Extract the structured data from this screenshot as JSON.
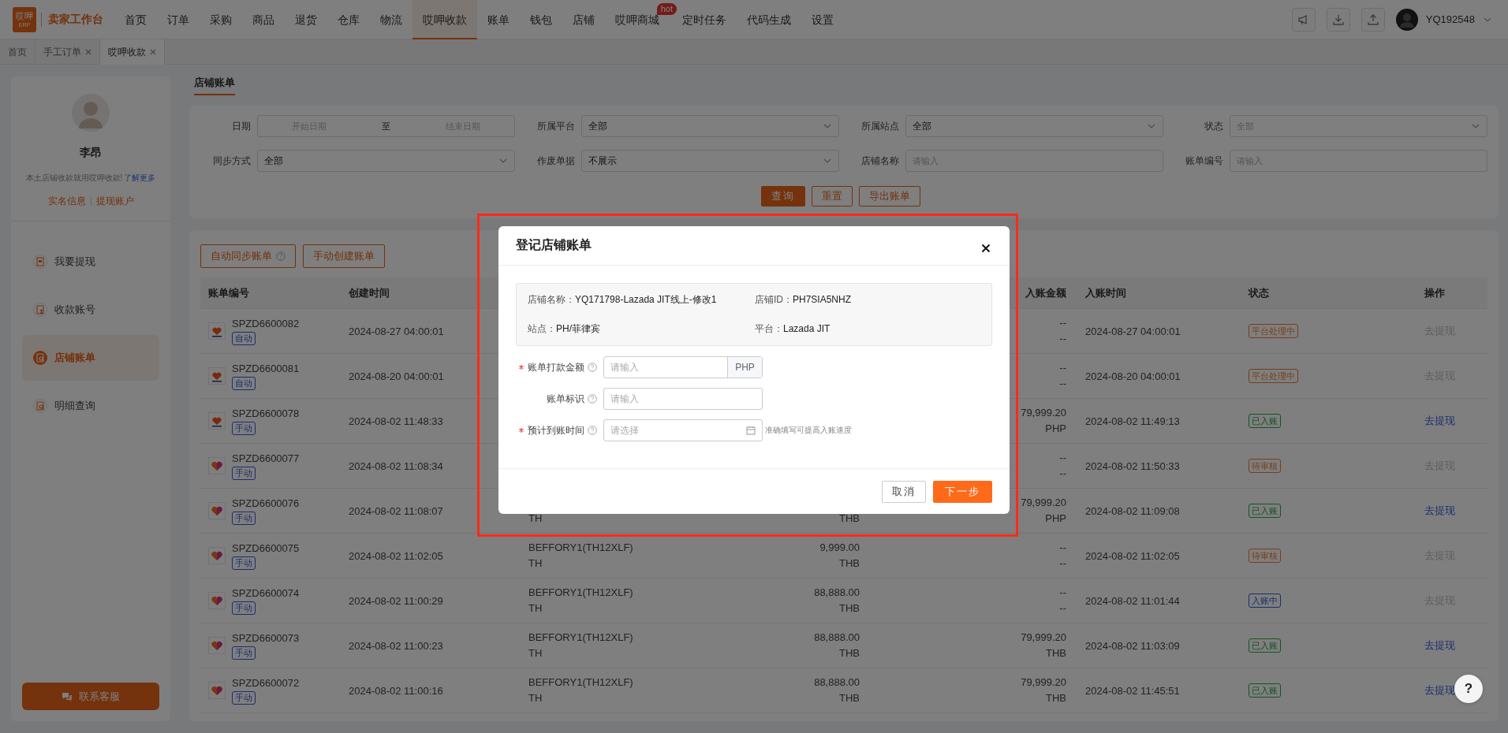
{
  "topbar": {
    "logo": {
      "mark": "哎呷",
      "sub": "ERP"
    },
    "title": "卖家工作台",
    "nav": [
      {
        "label": "首页",
        "selected": false
      },
      {
        "label": "订单",
        "selected": false
      },
      {
        "label": "采购",
        "selected": false
      },
      {
        "label": "商品",
        "selected": false
      },
      {
        "label": "退货",
        "selected": false
      },
      {
        "label": "仓库",
        "selected": false
      },
      {
        "label": "物流",
        "selected": false
      },
      {
        "label": "哎呷收款",
        "selected": true
      },
      {
        "label": "账单",
        "selected": false
      },
      {
        "label": "钱包",
        "selected": false
      },
      {
        "label": "店铺",
        "selected": false
      },
      {
        "label": "哎呷商城",
        "selected": false,
        "badge": "hot"
      },
      {
        "label": "定时任务",
        "selected": false
      },
      {
        "label": "代码生成",
        "selected": false
      },
      {
        "label": "设置",
        "selected": false
      }
    ],
    "user": "YQ192548"
  },
  "page_tabs": [
    {
      "label": "首页",
      "selected": false,
      "closable": false
    },
    {
      "label": "手工订单",
      "selected": false,
      "closable": true
    },
    {
      "label": "哎呷收款",
      "selected": true,
      "closable": true
    }
  ],
  "sidebar": {
    "name": "李昂",
    "promo": "本土店铺收款就用哎呷收款!",
    "promo_link": "了解更多",
    "links": [
      "实名信息",
      "提现账户"
    ],
    "items": [
      {
        "label": "我要提现",
        "selected": false,
        "kind": "withdraw"
      },
      {
        "label": "收款账号",
        "selected": false,
        "kind": "account"
      },
      {
        "label": "店铺账单",
        "selected": true,
        "kind": "bill"
      },
      {
        "label": "明细查询",
        "selected": false,
        "kind": "search"
      }
    ],
    "service_button": "联系客服"
  },
  "section_tab": "店铺账单",
  "filters": [
    {
      "label": "日期",
      "kind": "range",
      "start_placeholder": "开始日期",
      "separator": "至",
      "end_placeholder": "结束日期"
    },
    {
      "label": "所属平台",
      "kind": "select",
      "value": "全部"
    },
    {
      "label": "所属站点",
      "kind": "select",
      "value": "全部"
    },
    {
      "label": "状态",
      "kind": "select",
      "placeholder": "全部"
    },
    {
      "label": "同步方式",
      "kind": "select",
      "value": "全部"
    },
    {
      "label": "作废单据",
      "kind": "select",
      "value": "不展示"
    },
    {
      "label": "店铺名称",
      "kind": "input",
      "placeholder": "请输入"
    },
    {
      "label": "账单编号",
      "kind": "input",
      "placeholder": "请输入"
    }
  ],
  "filter_buttons": [
    {
      "label": "查询",
      "kind": "primary"
    },
    {
      "label": "重置",
      "kind": "plain"
    },
    {
      "label": "导出账单",
      "kind": "plain"
    }
  ],
  "toolbar": [
    {
      "label": "自动同步账单",
      "help": true
    },
    {
      "label": "手动创建账单",
      "help": false
    }
  ],
  "table": {
    "headers": {
      "bill_no": "账单编号",
      "created": "创建时间",
      "credited_amount": "入账金额",
      "credited_time": "入账时间",
      "status": "状态",
      "action": "操作"
    },
    "rows": [
      {
        "kind": "jit",
        "bill_no": "SPZD6600082",
        "tag": "自动",
        "created": "2024-08-27 04:00:01",
        "credited_amount": [
          "--",
          "--"
        ],
        "credited_time": "2024-08-27 04:00:01",
        "status": {
          "text": "平台处理中",
          "color": "#783e1d"
        },
        "action": {
          "text": "去提现",
          "disabled": true
        }
      },
      {
        "kind": "jit",
        "bill_no": "SPZD6600081",
        "tag": "自动",
        "created": "2024-08-20 04:00:01",
        "credited_amount": [
          "--",
          "--"
        ],
        "credited_time": "2024-08-20 04:00:01",
        "status": {
          "text": "平台处理中",
          "color": "#783e1d"
        },
        "action": {
          "text": "去提现",
          "disabled": true
        }
      },
      {
        "kind": "jit",
        "bill_no": "SPZD6600078",
        "tag": "手动",
        "created": "2024-08-02 11:48:33",
        "credited_amount": [
          "79,999.20",
          "PHP"
        ],
        "credited_time": "2024-08-02 11:49:13",
        "status": {
          "text": "已入账",
          "color": "#175228"
        },
        "action": {
          "text": "去提现",
          "disabled": false
        }
      },
      {
        "kind": "plain",
        "bill_no": "SPZD6600077",
        "tag": "手动",
        "created": "2024-08-02 11:08:34",
        "credited_amount": [
          "--",
          "--"
        ],
        "credited_time": "2024-08-02 11:50:33",
        "status": {
          "text": "待审核",
          "color": "#783e1d"
        },
        "action": {
          "text": "去提现",
          "disabled": true
        }
      },
      {
        "kind": "plain",
        "bill_no": "SPZD6600076",
        "tag": "手动",
        "created": "2024-08-02 11:08:07",
        "shop": {
          "site": "TH"
        },
        "amount": {
          "currency": "THB"
        },
        "credited_amount": [
          "79,999.20",
          "PHP"
        ],
        "credited_time": "2024-08-02 11:09:08",
        "status": {
          "text": "已入账",
          "color": "#175228"
        },
        "action": {
          "text": "去提现",
          "disabled": false
        }
      },
      {
        "kind": "plain",
        "bill_no": "SPZD6600075",
        "tag": "手动",
        "created": "2024-08-02 11:02:05",
        "shop": {
          "name": "BEFFORY1(TH12XLF)",
          "site": "TH"
        },
        "amount": {
          "value": "9,999.00",
          "currency": "THB"
        },
        "credited_amount": [
          "--",
          "--"
        ],
        "credited_time": "2024-08-02 11:02:05",
        "status": {
          "text": "待审核",
          "color": "#783e1d"
        },
        "action": {
          "text": "去提现",
          "disabled": true
        }
      },
      {
        "kind": "plain",
        "bill_no": "SPZD6600074",
        "tag": "手动",
        "created": "2024-08-02 11:00:29",
        "shop": {
          "name": "BEFFORY1(TH12XLF)",
          "site": "TH"
        },
        "amount": {
          "value": "88,888.00",
          "currency": "THB"
        },
        "credited_amount": [
          "--",
          "--"
        ],
        "credited_time": "2024-08-02 11:01:44",
        "status": {
          "text": "入账中",
          "color": "#1d2e6c"
        },
        "action": {
          "text": "去提现",
          "disabled": true
        }
      },
      {
        "kind": "plain",
        "bill_no": "SPZD6600073",
        "tag": "手动",
        "created": "2024-08-02 11:00:23",
        "shop": {
          "name": "BEFFORY1(TH12XLF)",
          "site": "TH"
        },
        "amount": {
          "value": "88,888.00",
          "currency": "THB"
        },
        "credited_amount": [
          "79,999.20",
          "THB"
        ],
        "credited_time": "2024-08-02 11:03:09",
        "status": {
          "text": "已入账",
          "color": "#175228"
        },
        "action": {
          "text": "去提现",
          "disabled": false
        }
      },
      {
        "kind": "plain",
        "bill_no": "SPZD6600072",
        "tag": "手动",
        "created": "2024-08-02 11:00:16",
        "shop": {
          "name": "BEFFORY1(TH12XLF)",
          "site": "TH"
        },
        "amount": {
          "value": "88,888.00",
          "currency": "THB"
        },
        "credited_amount": [
          "79,999.20",
          "THB"
        ],
        "credited_time": "2024-08-02 11:45:51",
        "status": {
          "text": "已入账",
          "color": "#175228"
        },
        "action": {
          "text": "去提现",
          "disabled": false
        }
      }
    ]
  },
  "help_button": "?",
  "modal": {
    "title": "登记店铺账单",
    "info": [
      {
        "label": "店铺名称：",
        "value": "YQ171798-Lazada JIT线上-修改1"
      },
      {
        "label": "店铺ID：",
        "value": "PH7SIA5NHZ"
      },
      {
        "label": "站点：",
        "value": "PH/菲律宾"
      },
      {
        "label": "平台：",
        "value": "Lazada JIT"
      }
    ],
    "fields": [
      {
        "label": "账单打款金额",
        "required": true,
        "kind": "amount",
        "placeholder": "请输入",
        "suffix": "PHP"
      },
      {
        "label": "账单标识",
        "required": false,
        "kind": "input",
        "placeholder": "请输入"
      },
      {
        "label": "预计到账时间",
        "required": true,
        "kind": "date",
        "placeholder": "请选择",
        "hint": "准确填写可提高入账速度"
      }
    ],
    "buttons": [
      {
        "label": "取消",
        "kind": "plain"
      },
      {
        "label": "下一步",
        "kind": "primary"
      }
    ]
  }
}
